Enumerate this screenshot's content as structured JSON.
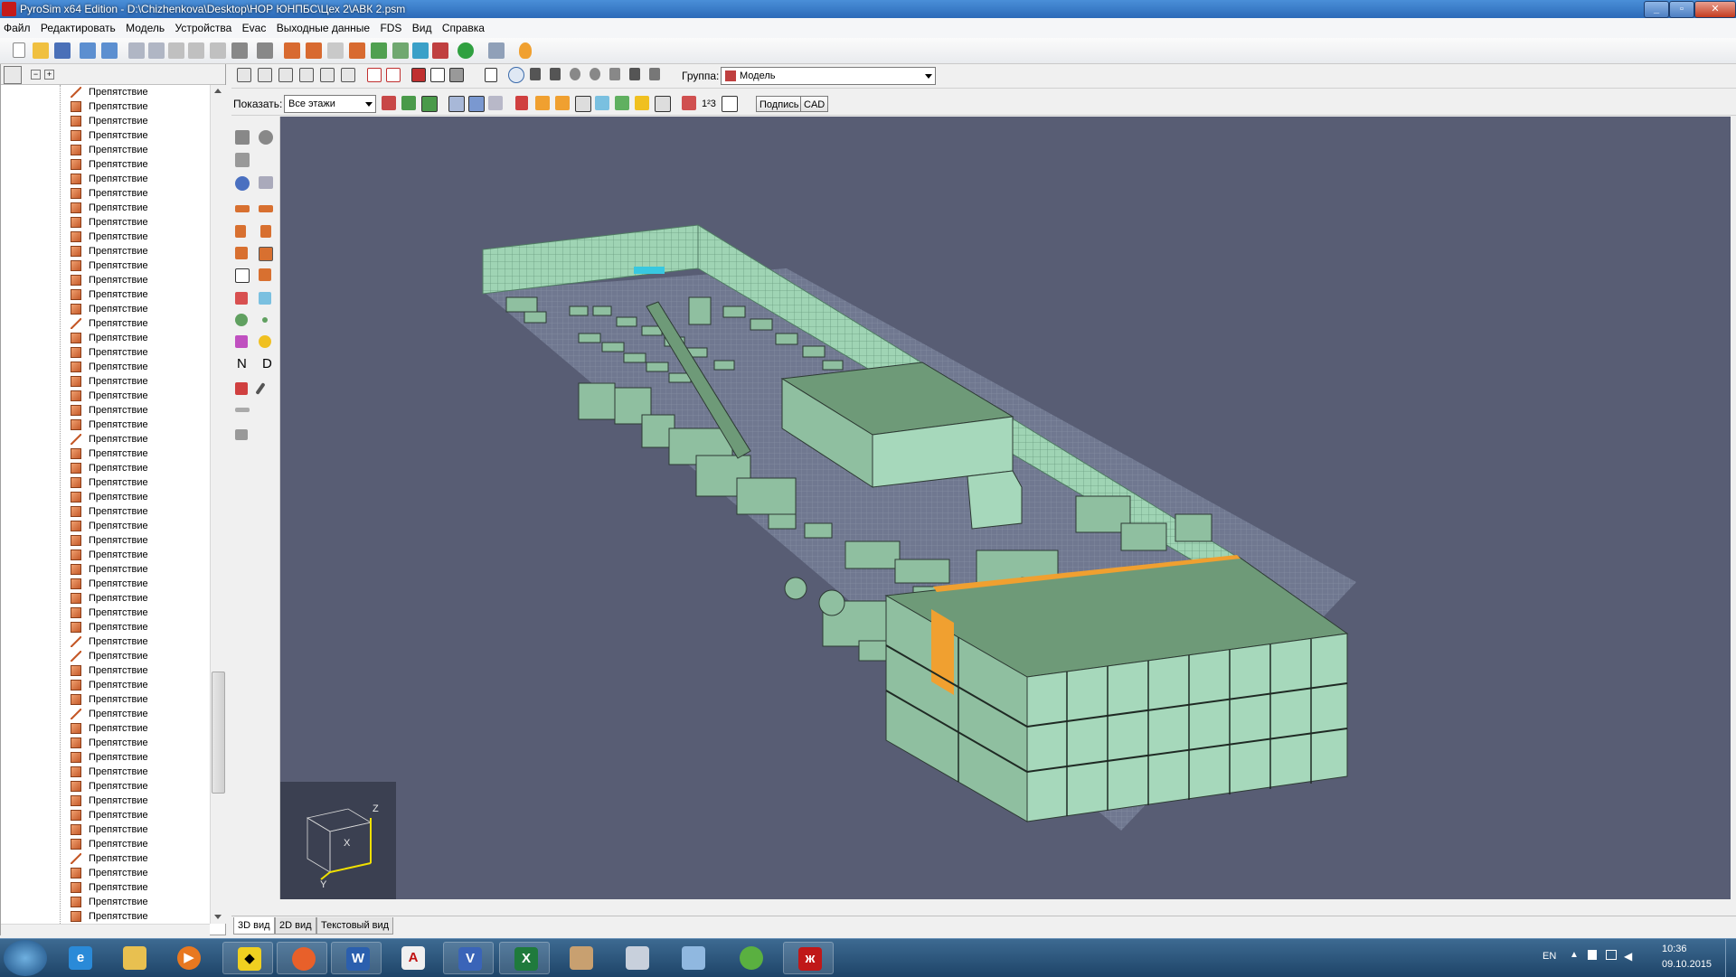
{
  "window": {
    "title": "PyroSim x64 Edition - D:\\Chizhenkova\\Desktop\\НОР ЮНПБС\\Цех 2\\АВК 2.psm"
  },
  "menu": [
    "Файл",
    "Редактировать",
    "Модель",
    "Устройства",
    "Evac",
    "Выходные данные",
    "FDS",
    "Вид",
    "Справка"
  ],
  "view_toolbar": {
    "group_label": "Группа:",
    "group_value": "Модель",
    "show_label": "Показать:",
    "show_value": "Все этажи",
    "caption_button": "Подпись",
    "cad_button": "CAD",
    "superscript_button": "1²3"
  },
  "side_toolbar_letters": {
    "n": "N",
    "d": "D"
  },
  "tree": {
    "item_label": "Препятствие",
    "items": [
      "Препятствие",
      "Препятствие",
      "Препятствие",
      "Препятствие",
      "Препятствие",
      "Препятствие",
      "Препятствие",
      "Препятствие",
      "Препятствие",
      "Препятствие",
      "Препятствие",
      "Препятствие",
      "Препятствие",
      "Препятствие",
      "Препятствие",
      "Препятствие",
      "Препятствие",
      "Препятствие",
      "Препятствие",
      "Препятствие",
      "Препятствие",
      "Препятствие",
      "Препятствие",
      "Препятствие",
      "Препятствие",
      "Препятствие",
      "Препятствие",
      "Препятствие",
      "Препятствие",
      "Препятствие",
      "Препятствие",
      "Препятствие",
      "Препятствие",
      "Препятствие",
      "Препятствие",
      "Препятствие",
      "Препятствие",
      "Препятствие",
      "Препятствие",
      "Препятствие",
      "Препятствие",
      "Препятствие",
      "Препятствие",
      "Препятствие",
      "Препятствие",
      "Препятствие",
      "Препятствие",
      "Препятствие",
      "Препятствие",
      "Препятствие",
      "Препятствие",
      "Препятствие",
      "Препятствие",
      "Препятствие",
      "Препятствие",
      "Препятствие",
      "Препятствие",
      "Препятствие"
    ],
    "slashed_icon_rows": [
      0,
      16,
      24,
      38,
      39,
      43,
      53
    ]
  },
  "tabs": [
    "3D вид",
    "2D вид",
    "Текстовый вид"
  ],
  "axes": {
    "x": "X",
    "y": "Y",
    "z": "Z"
  },
  "taskbar": {
    "apps": [
      "internet-explorer",
      "file-explorer",
      "media-player",
      "batman",
      "firefox",
      "word",
      "acrobat",
      "visio",
      "excel",
      "user-app",
      "calculator",
      "display-app",
      "frog-app",
      "pyrosim"
    ],
    "language": "EN",
    "time": "10:36",
    "date": "09.10.2015"
  },
  "colors": {
    "viewport_bg": "#585d74",
    "model_green": "#6e9a78",
    "model_light": "#a6d8bb",
    "highlight_orange": "#f0a030"
  }
}
